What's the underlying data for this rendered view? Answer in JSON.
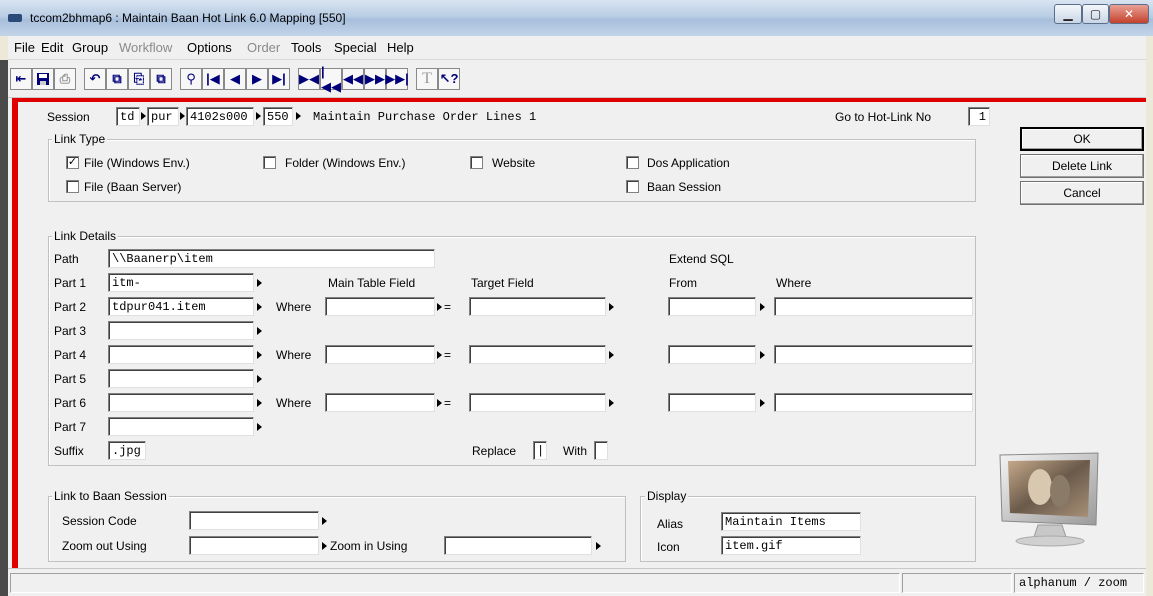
{
  "window": {
    "title": "tccom2bhmap6 : Maintain Baan Hot Link 6.0 Mapping [550]"
  },
  "menu": [
    {
      "label": "File",
      "key": "F",
      "rest": "ile",
      "enabled": true
    },
    {
      "label": "Edit",
      "key": "E",
      "rest": "dit",
      "enabled": true
    },
    {
      "label": "Group",
      "key": "G",
      "rest": "roup",
      "enabled": true
    },
    {
      "label": "Workflow",
      "key": "W",
      "rest": "orkflow",
      "enabled": false
    },
    {
      "label": "Options",
      "key": "O",
      "rest": "ptions",
      "enabled": true
    },
    {
      "label": "Order",
      "key": "d",
      "rest": "Or|er",
      "enabled": false
    },
    {
      "label": "Tools",
      "key": "T",
      "rest": "ools",
      "enabled": true
    },
    {
      "label": "Special",
      "key": "S",
      "rest": "pecial",
      "enabled": true
    },
    {
      "label": "Help",
      "key": "H",
      "rest": "elp",
      "enabled": true
    }
  ],
  "session": {
    "label": "Session",
    "package": "td",
    "module": "pur",
    "code": "4102s000",
    "number": "550",
    "description": "Maintain Purchase Order Lines 1",
    "goto_label": "Go to Hot-Link No",
    "goto_value": "1"
  },
  "link_type": {
    "title": "Link Type",
    "options": [
      {
        "label": "File (Windows Env.)",
        "checked": true
      },
      {
        "label": "Folder (Windows Env.)",
        "checked": false
      },
      {
        "label": "Website",
        "checked": false
      },
      {
        "label": "Dos Application",
        "checked": false
      },
      {
        "label": "File (Baan Server)",
        "checked": false
      },
      {
        "label": "Baan Session",
        "checked": false
      }
    ]
  },
  "link_details": {
    "title": "Link Details",
    "path_label": "Path",
    "path_value": "\\\\Baanerp\\item",
    "extend_sql": "Extend SQL",
    "col_main": "Main Table Field",
    "col_target": "Target Field",
    "col_from": "From",
    "col_where": "Where",
    "where_label": "Where",
    "eq": "=",
    "parts": [
      {
        "label": "Part 1",
        "value": "itm-"
      },
      {
        "label": "Part 2",
        "value": "tdpur041.item"
      },
      {
        "label": "Part 3",
        "value": ""
      },
      {
        "label": "Part 4",
        "value": ""
      },
      {
        "label": "Part 5",
        "value": ""
      },
      {
        "label": "Part 6",
        "value": ""
      },
      {
        "label": "Part 7",
        "value": ""
      }
    ],
    "suffix_label": "Suffix",
    "suffix_value": ".jpg",
    "replace_label": "Replace",
    "replace_value": "|",
    "with_label": "With",
    "with_value": ""
  },
  "baan_session": {
    "title": "Link to Baan Session",
    "session_code_label": "Session Code",
    "session_code_value": "",
    "zoom_out_label": "Zoom out Using",
    "zoom_out_value": "",
    "zoom_in_label": "Zoom in Using",
    "zoom_in_value": ""
  },
  "display": {
    "title": "Display",
    "alias_label": "Alias",
    "alias_value": "Maintain Items",
    "icon_label": "Icon",
    "icon_value": "item.gif"
  },
  "buttons": {
    "ok": "OK",
    "delete": "Delete Link",
    "cancel": "Cancel"
  },
  "status": {
    "field_type": "alphanum / zoom"
  },
  "colors": {
    "frame_red": "#e00000",
    "titlebar": "#b9cde4",
    "face": "#f0f0f0"
  }
}
